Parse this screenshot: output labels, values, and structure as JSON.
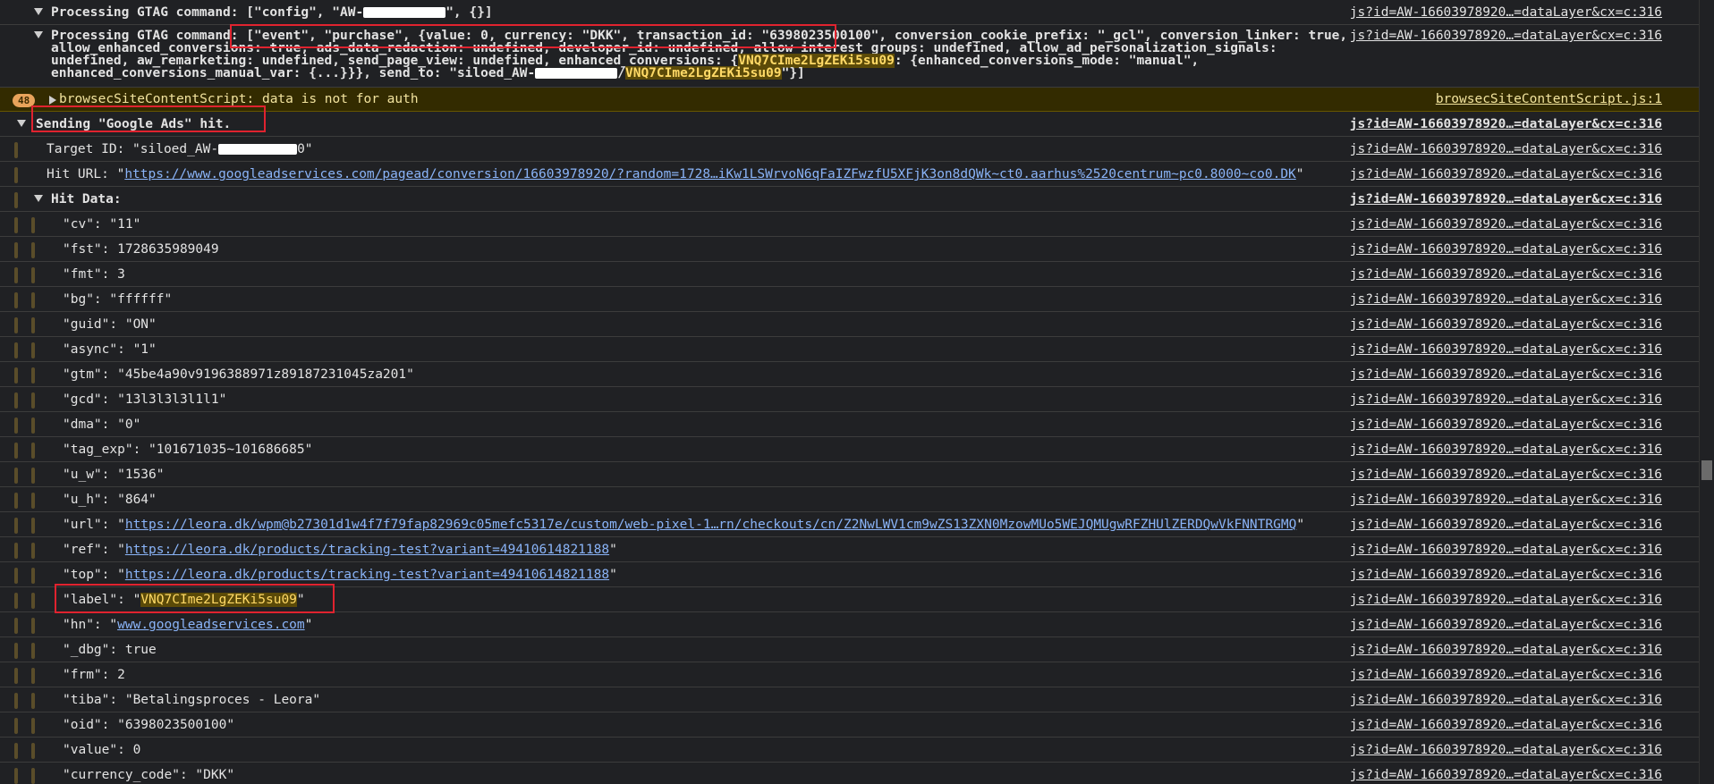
{
  "rows": {
    "r1": {
      "text_a": "Processing GTAG command: [\"config\", \"AW-",
      "text_b": "\", {}]",
      "src": "js?id=AW-16603978920…=dataLayer&cx=c:316"
    },
    "r2": {
      "prefix": "Processing GTAG command: ",
      "part1": "[\"event\", \"purchase\", {value: 0, currency: \"DKK\", transaction_id: \"6398023500100\"",
      "part2": ", conversion_cookie_prefix: \"_gcl\", conversion_linker: true, allow_enhanced_conversions: true, ads_data_redaction: undefined, developer_id: undefined, allow_interest_groups: undefined, allow_ad_personalization_signals: undefined, aw_remarketing: undefined, send_page_view: undefined, enhanced_conversions: {",
      "hl_label": "VNQ7CIme2LgZEKi5su09",
      "part3": ": {enhanced_conversions_mode: \"manual\", enhanced_conversions_manual_var: {...}}}, send_to: \"siloed_AW-",
      "part4": "/",
      "part5": "\"}]",
      "src": "js?id=AW-16603978920…=dataLayer&cx=c:316"
    },
    "warn": {
      "count": "48",
      "text": "browsecSiteContentScript: data is not for auth",
      "src": "browsecSiteContentScript.js:1"
    },
    "sending": {
      "text": "Sending \"Google Ads\" hit.",
      "src": "js?id=AW-16603978920…=dataLayer&cx=c:316"
    },
    "target": {
      "text_a": "Target ID: \"siloed_AW-",
      "text_b": "0\"",
      "src": "js?id=AW-16603978920…=dataLayer&cx=c:316"
    },
    "hiturl": {
      "label": "Hit URL: \"",
      "url": "https://www.googleadservices.com/pagead/conversion/16603978920/?random=1728…iKw1LSWrvoN6qFaIZFwzfU5XFjK3on8dQWk~ct0.aarhus%2520centrum~pc0.8000~co0.DK",
      "end": "\"",
      "src": "js?id=AW-16603978920…=dataLayer&cx=c:316"
    },
    "hitdata": {
      "text": "Hit Data:",
      "src": "js?id=AW-16603978920…=dataLayer&cx=c:316"
    }
  },
  "hit_data": [
    {
      "key": "\"cv\": ",
      "value": "\"11\""
    },
    {
      "key": "\"fst\": ",
      "value": "1728635989049"
    },
    {
      "key": "\"fmt\": ",
      "value": "3"
    },
    {
      "key": "\"bg\": ",
      "value": "\"ffffff\""
    },
    {
      "key": "\"guid\": ",
      "value": "\"ON\""
    },
    {
      "key": "\"async\": ",
      "value": "\"1\""
    },
    {
      "key": "\"gtm\": ",
      "value": "\"45be4a90v9196388971z89187231045za201\""
    },
    {
      "key": "\"gcd\": ",
      "value": "\"13l3l3l3l1l1\""
    },
    {
      "key": "\"dma\": ",
      "value": "\"0\""
    },
    {
      "key": "\"tag_exp\": ",
      "value": "\"101671035~101686685\""
    },
    {
      "key": "\"u_w\": ",
      "value": "\"1536\""
    },
    {
      "key": "\"u_h\": ",
      "value": "\"864\""
    },
    {
      "key": "\"url\": ",
      "value_link": "https://leora.dk/wpm@b27301d1w4f7f79fap82969c05mefc5317e/custom/web-pixel-1…rn/checkouts/cn/Z2NwLWV1cm9wZS13ZXN0MzowMUo5WEJQMUgwRFZHUlZERDQwVkFNNTRGMQ"
    },
    {
      "key": "\"ref\": ",
      "value_link": "https://leora.dk/products/tracking-test?variant=49410614821188"
    },
    {
      "key": "\"top\": ",
      "value_link": "https://leora.dk/products/tracking-test?variant=49410614821188"
    },
    {
      "key": "\"label\": ",
      "value_hl": "VNQ7CIme2LgZEKi5su09"
    },
    {
      "key": "\"hn\": ",
      "value_link": "www.googleadservices.com"
    },
    {
      "key": "\"_dbg\": ",
      "value": "true"
    },
    {
      "key": "\"frm\": ",
      "value": "2"
    },
    {
      "key": "\"tiba\": ",
      "value": "\"Betalingsproces - Leora\""
    },
    {
      "key": "\"oid\": ",
      "value": "\"6398023500100\""
    },
    {
      "key": "\"value\": ",
      "value": "0"
    },
    {
      "key": "\"currency_code\": ",
      "value": "\"DKK\""
    }
  ],
  "hit_src": "js?id=AW-16603978920…=dataLayer&cx=c:316",
  "colors": {
    "background": "#202124",
    "link": "#8ab4f8",
    "highlight": "#5b4a08",
    "redbox": "#e0232f",
    "warning_bg": "#332b00"
  }
}
